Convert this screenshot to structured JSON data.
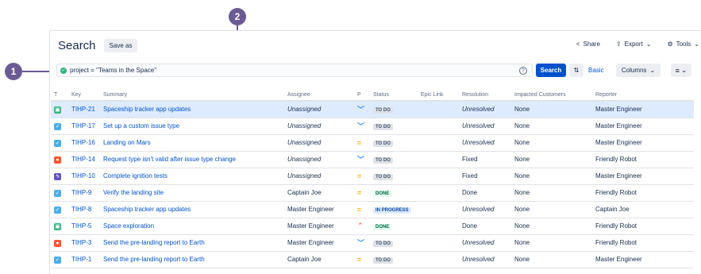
{
  "callouts": [
    "1",
    "2"
  ],
  "header": {
    "title": "Search",
    "save_as": "Save as",
    "share": "Share",
    "export": "Export",
    "tools": "Tools"
  },
  "query": {
    "text": "project = \"Teams in the Space\"",
    "help": "?",
    "search_button": "Search",
    "basic_link": "Basic",
    "columns_button": "Columns"
  },
  "table": {
    "headers": [
      "T",
      "Key",
      "Summary",
      "Assignee",
      "P",
      "Status",
      "Epic Link",
      "Resolution",
      "Impacted Customers",
      "Reporter"
    ],
    "rows": [
      {
        "type": "story",
        "key": "TIHP-21",
        "summary": "Spaceship tracker app updates",
        "assignee": "Unassigned",
        "priority": "low",
        "status": "TO DO",
        "epic": "",
        "resolution": "Unresolved",
        "impacted": "None",
        "reporter": "Master Engineer"
      },
      {
        "type": "task",
        "key": "TIHP-17",
        "summary": "Set up a custom issue type",
        "assignee": "Unassigned",
        "priority": "low",
        "status": "TO DO",
        "epic": "",
        "resolution": "Unresolved",
        "impacted": "None",
        "reporter": "Master Engineer"
      },
      {
        "type": "task",
        "key": "TIHP-16",
        "summary": "Landing on Mars",
        "assignee": "Unassigned",
        "priority": "medium",
        "status": "TO DO",
        "epic": "",
        "resolution": "Unresolved",
        "impacted": "None",
        "reporter": "Master Engineer"
      },
      {
        "type": "bug",
        "key": "TIHP-14",
        "summary": "Request type isn't valid after issue type change",
        "assignee": "Unassigned",
        "priority": "low",
        "status": "TO DO",
        "epic": "",
        "resolution": "Fixed",
        "impacted": "None",
        "reporter": "Friendly Robot"
      },
      {
        "type": "subtask",
        "key": "TIHP-10",
        "summary": "Complete ignition tests",
        "assignee": "Unassigned",
        "priority": "medium",
        "status": "TO DO",
        "epic": "",
        "resolution": "Fixed",
        "impacted": "None",
        "reporter": "Master Engineer"
      },
      {
        "type": "task",
        "key": "TIHP-9",
        "summary": "Verify the landing site",
        "assignee": "Captain Joe",
        "priority": "medium",
        "status": "DONE",
        "epic": "",
        "resolution": "Done",
        "impacted": "None",
        "reporter": "Friendly Robot"
      },
      {
        "type": "task",
        "key": "TIHP-8",
        "summary": "Spaceship tracker app updates",
        "assignee": "Master Engineer",
        "priority": "medium",
        "status": "IN PROGRESS",
        "epic": "",
        "resolution": "Unresolved",
        "impacted": "None",
        "reporter": "Captain Joe"
      },
      {
        "type": "story",
        "key": "TIHP-5",
        "summary": "Space exploration",
        "assignee": "Master Engineer",
        "priority": "high",
        "status": "DONE",
        "epic": "",
        "resolution": "Done",
        "impacted": "None",
        "reporter": "Friendly Robot"
      },
      {
        "type": "bug",
        "key": "TIHP-3",
        "summary": "Send the pre-landing report to Earth",
        "assignee": "Master Engineer",
        "priority": "low",
        "status": "TO DO",
        "epic": "",
        "resolution": "Unresolved",
        "impacted": "None",
        "reporter": "Friendly Robot"
      },
      {
        "type": "task",
        "key": "TIHP-1",
        "summary": "Send the pre-landing report to Earth",
        "assignee": "Captain Joe",
        "priority": "medium",
        "status": "TO DO",
        "epic": "",
        "resolution": "Unresolved",
        "impacted": "None",
        "reporter": "Master Engineer"
      }
    ]
  },
  "colors": {
    "accent": "#0052cc",
    "callout": "#6b5b95",
    "selected_row": "#deebff"
  }
}
